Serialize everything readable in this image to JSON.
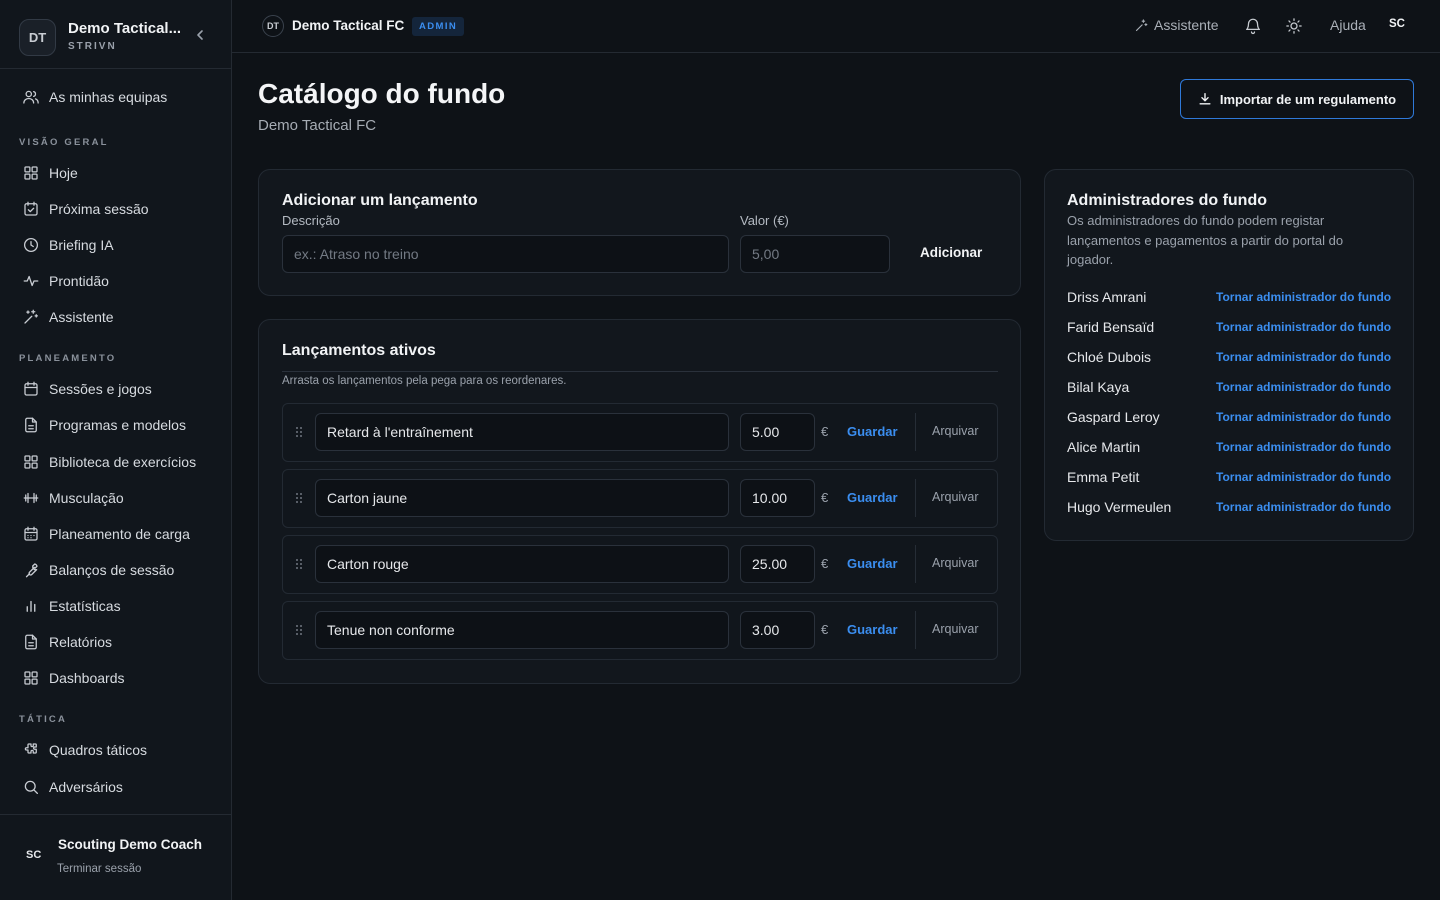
{
  "sidebar": {
    "brand": {
      "avatar": "DT",
      "name": "Demo Tactical...",
      "sub": "STRIVN"
    },
    "my_teams": "As minhas equipas",
    "sections": [
      {
        "title": "VISÃO GERAL",
        "items": [
          "Hoje",
          "Próxima sessão",
          "Briefing IA",
          "Prontidão",
          "Assistente"
        ]
      },
      {
        "title": "PLANEAMENTO",
        "items": [
          "Sessões e jogos",
          "Programas e modelos",
          "Biblioteca de exercícios",
          "Musculação",
          "Planeamento de carga",
          "Balanços de sessão",
          "Estatísticas",
          "Relatórios",
          "Dashboards"
        ]
      },
      {
        "title": "TÁTICA",
        "items": [
          "Quadros táticos",
          "Adversários"
        ]
      }
    ],
    "user": {
      "avatar": "SC",
      "name": "Scouting Demo Coach",
      "logout": "Terminar sessão"
    }
  },
  "topbar": {
    "avatar": "DT",
    "team": "Demo Tactical FC",
    "badge": "ADMIN",
    "assistant": "Assistente",
    "help": "Ajuda",
    "user": "SC"
  },
  "page": {
    "title": "Catálogo do fundo",
    "subtitle": "Demo Tactical FC",
    "import_button": "Importar de um regulamento"
  },
  "add_form": {
    "title": "Adicionar um lançamento",
    "description_label": "Descrição",
    "description_placeholder": "ex.: Atraso no treino",
    "value_label": "Valor (€)",
    "value_placeholder": "5,00",
    "add_button": "Adicionar"
  },
  "active": {
    "title": "Lançamentos ativos",
    "hint": "Arrasta os lançamentos pela pega para os reordenares.",
    "currency": "€",
    "save_label": "Guardar",
    "archive_label": "Arquivar",
    "rows": [
      {
        "name": "Retard à l'entraînement",
        "value": "5.00"
      },
      {
        "name": "Carton jaune",
        "value": "10.00"
      },
      {
        "name": "Carton rouge",
        "value": "25.00"
      },
      {
        "name": "Tenue non conforme",
        "value": "3.00"
      }
    ]
  },
  "admins": {
    "title": "Administradores do fundo",
    "description": "Os administradores do fundo podem registar lançamentos e pagamentos a partir do portal do jogador.",
    "action_label": "Tornar administrador do fundo",
    "players": [
      "Driss Amrani",
      "Farid Bensaïd",
      "Chloé Dubois",
      "Bilal Kaya",
      "Gaspard Leroy",
      "Alice Martin",
      "Emma Petit",
      "Hugo Vermeulen"
    ]
  },
  "colors": {
    "accent": "#3b8ef0",
    "background": "#0e1217",
    "card": "#12171d"
  }
}
